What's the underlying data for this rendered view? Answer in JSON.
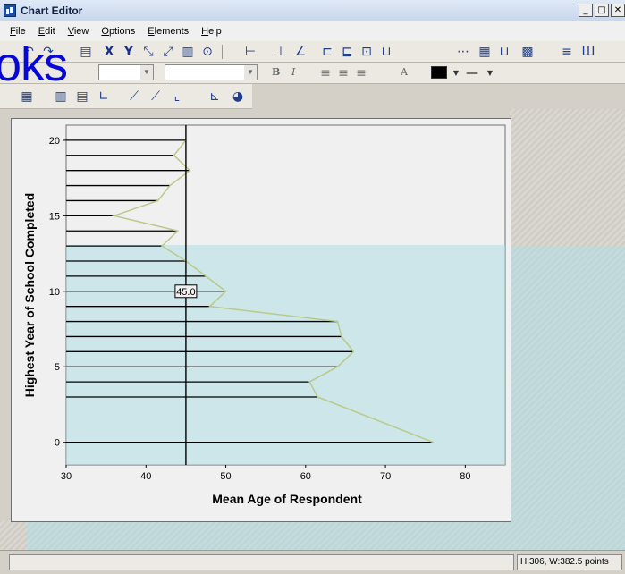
{
  "window": {
    "title": "Chart Editor",
    "buttons": [
      "_",
      "□",
      "✕"
    ]
  },
  "menu": [
    "File",
    "Edit",
    "View",
    "Options",
    "Elements",
    "Help"
  ],
  "watermark_text": "oks",
  "format_bar": {
    "bold": "B",
    "italic": "I",
    "text_color_label": "A"
  },
  "status": {
    "dimensions": "H:306, W:382.5 points"
  },
  "colors": {
    "bars": "#000000",
    "mean_line": "#000000",
    "ref_line": "#b9c98a",
    "plot_bg": "#f0f0f0"
  },
  "chart_data": {
    "type": "bar",
    "orientation": "horizontal",
    "xlabel": "Mean Age of Respondent",
    "ylabel": "Highest Year of School Completed",
    "xlim": [
      30,
      85
    ],
    "ylim": [
      -1.5,
      21
    ],
    "xticks": [
      30,
      40,
      50,
      60,
      70,
      80
    ],
    "yticks": [
      0,
      5,
      10,
      15,
      20
    ],
    "categories": [
      0,
      3,
      4,
      5,
      6,
      7,
      8,
      9,
      10,
      11,
      12,
      13,
      14,
      15,
      16,
      17,
      18,
      19,
      20
    ],
    "values": [
      76,
      61.5,
      60.5,
      64,
      66,
      64.5,
      64,
      48,
      50,
      47.5,
      45,
      42,
      44,
      36,
      41.5,
      43,
      45.5,
      43.5,
      45
    ],
    "reference_line": {
      "x": 45.0,
      "label": "45.0"
    }
  }
}
